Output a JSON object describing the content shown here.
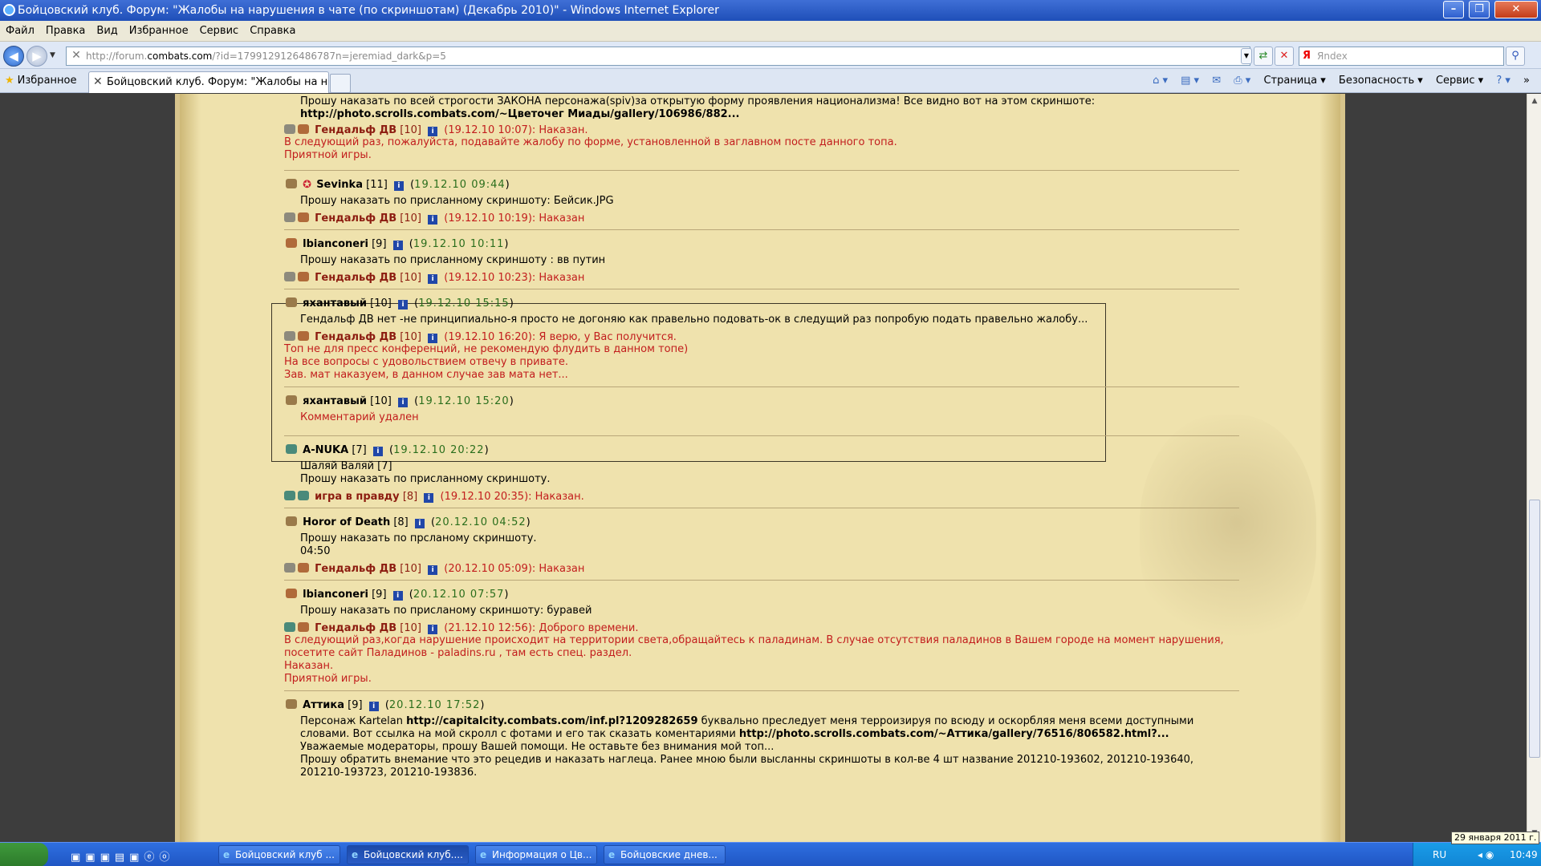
{
  "window": {
    "title": "Бойцовский клуб. Форум: \"Жалобы на нарушения в чате (по скриншотам) (Декабрь 2010)\" - Windows Internet Explorer",
    "min": "–",
    "max": "❐",
    "close": "✕"
  },
  "menu": [
    "Файл",
    "Правка",
    "Вид",
    "Избранное",
    "Сервис",
    "Справка"
  ],
  "address": {
    "prefix": "http://forum.",
    "host": "combats.com",
    "rest": "/?id=1799129126486787n=jeremiad_dark&p=5",
    "search_placeholder": "Яndex",
    "search_logo": "Я"
  },
  "favorites_label": "Избранное",
  "tab_title": "Бойцовский клуб. Форум: \"Жалобы на нару...",
  "commands": [
    "Страница ▾",
    "Безопасность ▾",
    "Сервис ▾",
    "? ▾"
  ],
  "posts": [
    {
      "body": [
        "Прошу наказать по всей строгости ЗАКОНА персонажа(spiv)за открытую форму проявления национализма! Все видно вот на этом скриншоте:"
      ],
      "link": "http://photo.scrolls.combats.com/~Цветочег Миады/gallery/106986/882...",
      "mod": {
        "name": "Гендальф ДВ",
        "lvl": "[10]",
        "date": "(19.12.10 10:07): Наказан.",
        "lines": [
          "В следующий раз, пожалуйста, подавайте жалобу по форме, установленной   в заглавном посте данного топа.",
          "Приятной игры."
        ]
      }
    },
    {
      "name": "Sevinka",
      "lvl": "[11]",
      "date": "19.12.10 09:44",
      "body": [
        "Прошу наказать по присланному скриншоту: Бейсик.JPG"
      ],
      "mod": {
        "name": "Гендальф ДВ",
        "lvl": "[10]",
        "date": "(19.12.10 10:19): Наказан",
        "lines": []
      }
    },
    {
      "name": "lbianconeri",
      "lvl": "[9]",
      "date": "19.12.10 10:11",
      "body": [
        "Прошу наказать по присланному скриншоту : вв путин"
      ],
      "mod": {
        "name": "Гендальф ДВ",
        "lvl": "[10]",
        "date": "(19.12.10 10:23): Наказан",
        "lines": []
      }
    },
    {
      "name": "яхантавый",
      "lvl": "[10]",
      "date": "19.12.10 15:15",
      "body": [
        "Гендальф ДВ нет -не принципиально-я просто не догоняю как правельно подовать-ок в следущий раз попробую подать правельно жалобу..."
      ],
      "mod": {
        "name": "Гендальф ДВ",
        "lvl": "[10]",
        "date": "(19.12.10 16:20): Я верю, у Вас получится.",
        "lines": [
          "Топ не для пресс конференций, не рекомендую флудить в данном топе)",
          "На все вопросы с удовольствием отвечу в привате.",
          "Зав. мат наказуем, в данном случае зав мата нет..."
        ]
      }
    },
    {
      "name": "яхантавый",
      "lvl": "[10]",
      "date": "19.12.10 15:20",
      "deleted": "Комментарий удален"
    },
    {
      "name": "A-NUKA",
      "lvl": "[7]",
      "date": "19.12.10 20:22",
      "body": [
        "Шаляй Валяй [7]",
        "Прошу наказать по присланному скриншоту."
      ],
      "mod": {
        "name": "игра в правду",
        "lvl": "[8]",
        "date": "(19.12.10 20:35): Наказан.",
        "lines": []
      }
    },
    {
      "name": "Horor of Death",
      "lvl": "[8]",
      "date": "20.12.10 04:52",
      "body": [
        "Прошу наказать по прсланому скриншоту.",
        "04:50"
      ],
      "mod": {
        "name": "Гендальф ДВ",
        "lvl": "[10]",
        "date": "(20.12.10 05:09): Наказан",
        "lines": []
      }
    },
    {
      "name": "lbianconeri",
      "lvl": "[9]",
      "date": "20.12.10 07:57",
      "body": [
        "Прошу наказать по присланому скриншоту: буравей"
      ],
      "mod": {
        "name": "Гендальф ДВ",
        "lvl": "[10]",
        "date": "(21.12.10 12:56): Доброго времени.",
        "lines": [
          "В следующий раз,когда нарушение происходит на территории света,обращайтесь к паладинам. В случае отсутствия паладинов в Вашем городе на момент нарушения,",
          "посетите сайт Паладинов - paladins.ru , там есть спец. раздел.",
          "Наказан.",
          "Приятной игры."
        ]
      }
    },
    {
      "name": "Аттика",
      "lvl": "[9]",
      "date": "20.12.10 17:52",
      "rich": [
        [
          "Персонаж Kartelan ",
          "http://capitalcity.combats.com/inf.pl?1209282659",
          " буквально преследует меня терроизируя по всюду и оскорбляя меня всеми доступными"
        ],
        [
          "словами. Вот ссылка на мой скролл с фотами и его так сказать коментариями ",
          "http://photo.scrolls.combats.com/~Аттика/gallery/76516/806582.html?...",
          ""
        ]
      ],
      "body": [
        "Уважаемые модераторы, прошу Вашей помощи. Не оставьте без внимания мой топ...",
        "Прошу обратить внемание что это рецедив и наказать наглеца. Ранее мною были высланны скриншоты в кол-ве 4 шт название 201210-193602, 201210-193640,",
        "201210-193723, 201210-193836."
      ]
    }
  ],
  "taskbar": {
    "tasks": [
      "Бойцовский клуб ...",
      "Бойцовский клуб....",
      "Информация о Цв...",
      "Бойцовские днев..."
    ],
    "lang": "RU",
    "time": "10:49",
    "tooltip": "29 января 2011 г."
  }
}
